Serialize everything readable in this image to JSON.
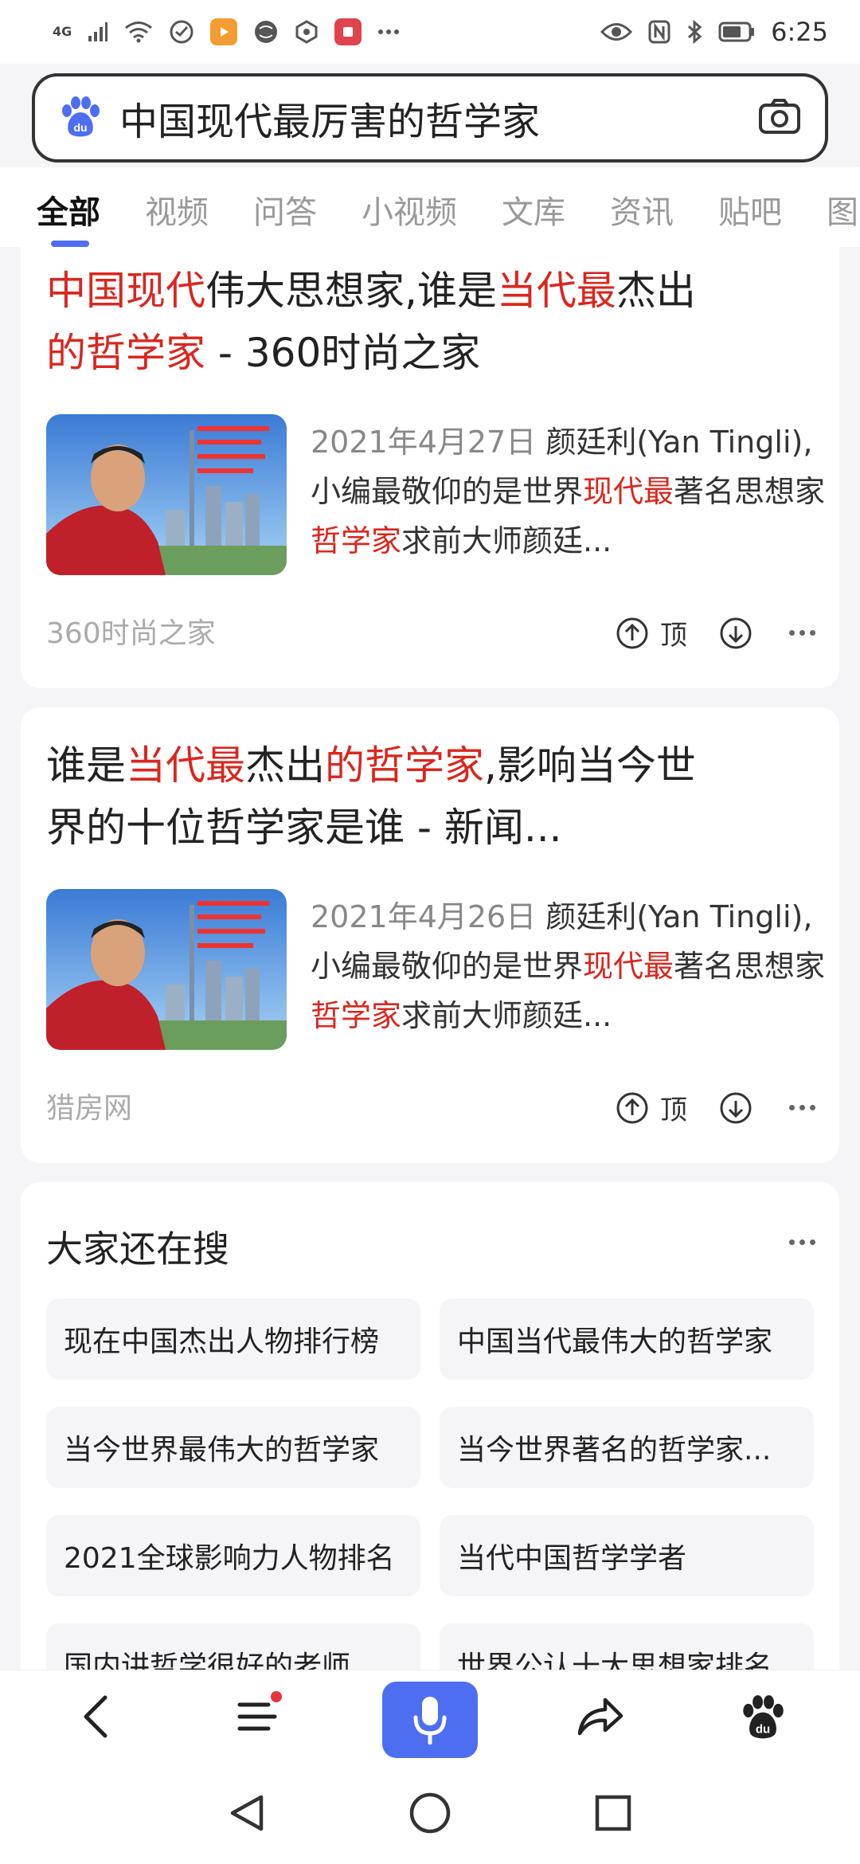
{
  "status_bar": {
    "network": "4G",
    "time": "6:25"
  },
  "search": {
    "query": "中国现代最厉害的哲学家"
  },
  "tabs": [
    {
      "label": "全部",
      "active": true
    },
    {
      "label": "视频"
    },
    {
      "label": "问答"
    },
    {
      "label": "小视频"
    },
    {
      "label": "文库"
    },
    {
      "label": "资讯"
    },
    {
      "label": "贴吧"
    },
    {
      "label": "图"
    }
  ],
  "results": [
    {
      "title_line1": [
        {
          "text": "中国现代",
          "hl": true
        },
        {
          "text": "伟大思想家,谁是",
          "hl": false
        },
        {
          "text": "当代最",
          "hl": true
        },
        {
          "text": "杰出",
          "hl": false
        }
      ],
      "title_line2": [
        {
          "text": "的哲学家",
          "hl": true
        },
        {
          "text": " - 360时尚之家",
          "hl": false
        }
      ],
      "date": "2021年4月27日",
      "snippet_a": " 颜廷利(Yan Tingli),小编最敬仰的是世界",
      "snippet_b": "现代最",
      "snippet_c": "著名思想家",
      "snippet_d": "哲学家",
      "snippet_e": "求前大师颜廷...",
      "source": "360时尚之家",
      "upvote_label": "顶"
    },
    {
      "title_line1": [
        {
          "text": "谁是",
          "hl": false
        },
        {
          "text": "当代最",
          "hl": true
        },
        {
          "text": "杰出",
          "hl": false
        },
        {
          "text": "的哲学家",
          "hl": true
        },
        {
          "text": ",影响当今世",
          "hl": false
        }
      ],
      "title_line2": [
        {
          "text": "界的十位哲学家是谁 - 新闻...",
          "hl": false
        }
      ],
      "date": "2021年4月26日",
      "snippet_a": " 颜廷利(Yan Tingli),小编最敬仰的是世界",
      "snippet_b": "现代最",
      "snippet_c": "著名思想家",
      "snippet_d": "哲学家",
      "snippet_e": "求前大师颜廷...",
      "source": "猎房网",
      "upvote_label": "顶"
    }
  ],
  "related": {
    "title": "大家还在搜",
    "items": [
      "现在中国杰出人物排行榜",
      "中国当代最伟大的哲学家",
      "当今世界最伟大的哲学家",
      "当今世界著名的哲学家...",
      "2021全球影响力人物排名",
      "当代中国哲学学者",
      "国内讲哲学很好的老师",
      "世界公认十大思想家排名"
    ]
  },
  "colors": {
    "accent": "#4e6ef2",
    "highlight": "#d9271e",
    "notification_dot": "#e8323c"
  }
}
